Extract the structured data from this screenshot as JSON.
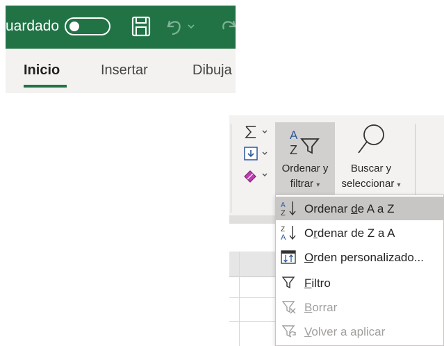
{
  "titlebar": {
    "autosave_label": "uardado",
    "toggle_state": "off",
    "accent": "#217346"
  },
  "tabs": {
    "items": [
      "Inicio",
      "Insertar",
      "Dibuja"
    ],
    "active": "Inicio"
  },
  "ribbon": {
    "sort_filter": {
      "line1": "Ordenar y",
      "line2": "filtrar",
      "caret": "▾"
    },
    "find_select": {
      "line1": "Buscar y",
      "line2": "seleccionar",
      "caret": "▾"
    },
    "small_buttons": [
      "autosum-icon",
      "fill-icon",
      "clear-icon"
    ]
  },
  "menu": {
    "items": [
      {
        "pre": "Ordenar ",
        "acc": "d",
        "post": "e A a Z",
        "icon": "sort-a-z-icon",
        "enabled": true,
        "hover": true
      },
      {
        "pre": "O",
        "acc": "r",
        "post": "denar de Z a A",
        "icon": "sort-z-a-icon",
        "enabled": true,
        "hover": false
      },
      {
        "pre": "",
        "acc": "O",
        "post": "rden personalizado...",
        "icon": "custom-sort-icon",
        "enabled": true,
        "hover": false
      },
      {
        "pre": "",
        "acc": "F",
        "post": "iltro",
        "icon": "filter-icon",
        "enabled": true,
        "hover": false
      },
      {
        "pre": "",
        "acc": "B",
        "post": "orrar",
        "icon": "clear-filter-icon",
        "enabled": false,
        "hover": false
      },
      {
        "pre": "",
        "acc": "V",
        "post": "olver a aplicar",
        "icon": "reapply-filter-icon",
        "enabled": false,
        "hover": false
      }
    ]
  }
}
